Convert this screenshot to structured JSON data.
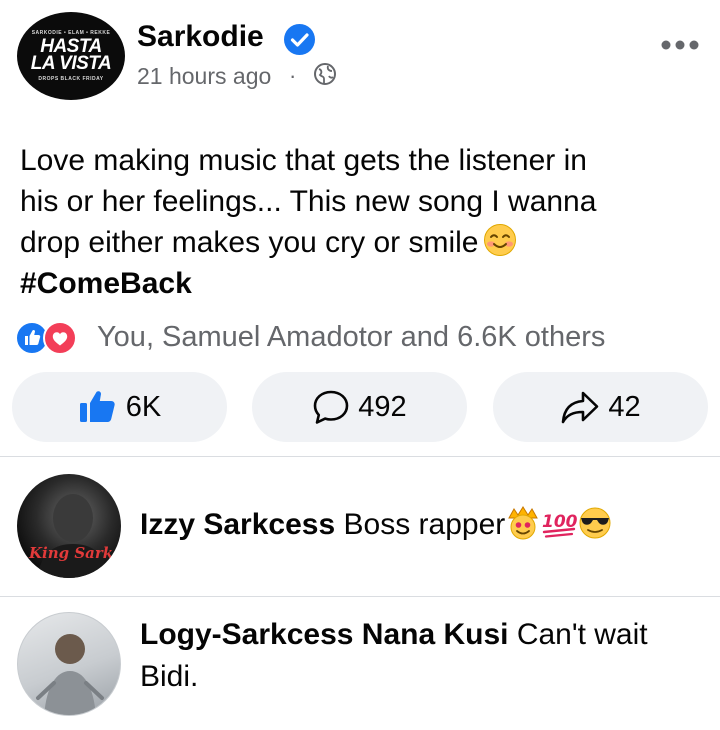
{
  "post": {
    "author": "Sarkodie",
    "avatar_text": {
      "top": "SARKODIE • ELAM • REKKE",
      "title_line1": "HASTA",
      "title_line2": "LA VISTA",
      "bottom": "DROPS BLACK FRIDAY"
    },
    "timestamp": "21 hours ago",
    "separator": "·",
    "privacy_icon": "globe-icon",
    "verified_icon": "verified-badge-icon",
    "more_icon": "more-options-icon",
    "text_lines": [
      "Love making music that gets the listener in",
      "his or her feelings... This new song I wanna",
      "drop either makes you cry or smile"
    ],
    "hashtag": "#ComeBack"
  },
  "reactions": {
    "icons": [
      "like-reaction-icon",
      "love-reaction-icon"
    ],
    "summary": "You, Samuel Amadotor and 6.6K others"
  },
  "actions": {
    "like_count": "6K",
    "comment_count": "492",
    "share_count": "42"
  },
  "comments": [
    {
      "author": "Izzy Sarkcess",
      "text": "Boss rapper",
      "avatar_caption": "King Sark",
      "emojis": [
        "crown-face-emoji",
        "hundred-points-emoji",
        "sunglasses-emoji"
      ]
    },
    {
      "author": "Logy-Sarkcess Nana Kusi",
      "text": "Can't wait Bidi."
    }
  ],
  "colors": {
    "accent": "#1877f2",
    "love": "#f33e58",
    "secondary_text": "#65676b",
    "button_bg": "#f0f2f5"
  }
}
